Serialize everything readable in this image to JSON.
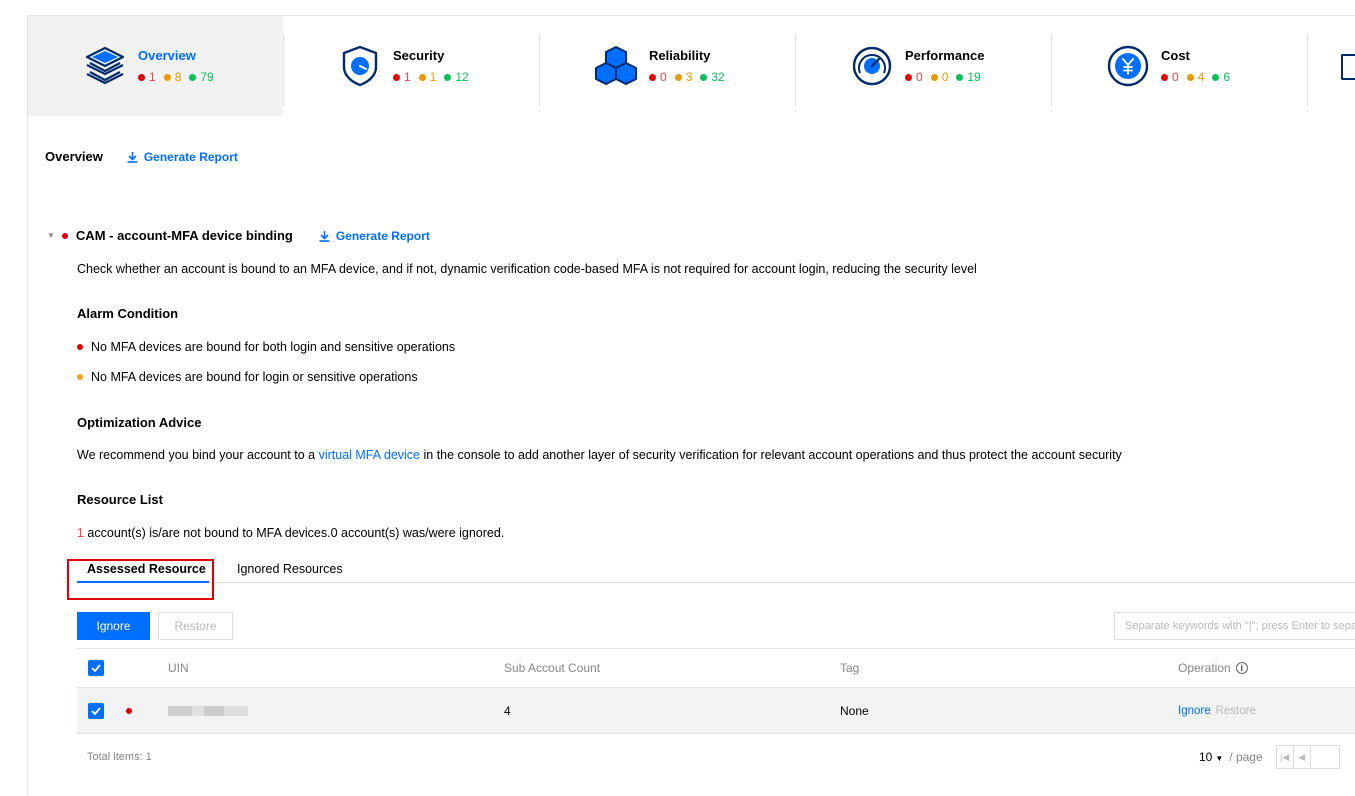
{
  "categories": [
    {
      "id": "overview",
      "title": "Overview",
      "counts": [
        "1",
        "8",
        "79"
      ],
      "active": true
    },
    {
      "id": "security",
      "title": "Security",
      "counts": [
        "1",
        "1",
        "12"
      ]
    },
    {
      "id": "reliability",
      "title": "Reliability",
      "counts": [
        "0",
        "3",
        "32"
      ]
    },
    {
      "id": "performance",
      "title": "Performance",
      "counts": [
        "0",
        "0",
        "19"
      ]
    },
    {
      "id": "cost",
      "title": "Cost",
      "counts": [
        "0",
        "4",
        "6"
      ]
    }
  ],
  "overview": {
    "title": "Overview",
    "generate_report": "Generate Report"
  },
  "item": {
    "title": "CAM - account-MFA device binding",
    "generate_report": "Generate Report",
    "description": "Check whether an account is bound to an MFA device, and if not, dynamic verification code-based MFA is not required for account login, reducing the security level",
    "alarm_heading": "Alarm Condition",
    "alarm_high": "No MFA devices are bound for both login and sensitive operations",
    "alarm_medium": "No MFA devices are bound for login or sensitive operations",
    "advice_heading": "Optimization Advice",
    "advice_pre": "We recommend you bind your account to a ",
    "advice_link": "virtual MFA device",
    "advice_post": " in the console to add another layer of security verification for relevant account operations and thus protect the account security",
    "resource_heading": "Resource List",
    "summary_count": "1",
    "summary_text": " account(s) is/are not bound to MFA devices.0  account(s) was/were ignored."
  },
  "subtabs": {
    "assessed": "Assessed Resource",
    "ignored": "Ignored Resources"
  },
  "toolbar": {
    "ignore": "Ignore",
    "restore": "Restore",
    "search_placeholder": "Separate keywords with \"|\"; press Enter to separate"
  },
  "table": {
    "columns": {
      "uin": "UIN",
      "sub_count": "Sub Accout Count",
      "tag": "Tag",
      "operation": "Operation"
    },
    "rows": [
      {
        "sub_count": "4",
        "tag": "None",
        "op_ignore": "Ignore",
        "op_restore": "Restore"
      }
    ]
  },
  "footer": {
    "total": "Total items: 1",
    "page_size": "10",
    "per_page": "/ page"
  },
  "colors": {
    "accent": "#006eff",
    "high": "#e1000a",
    "medium": "#e89a00",
    "low": "#0abf5b"
  }
}
